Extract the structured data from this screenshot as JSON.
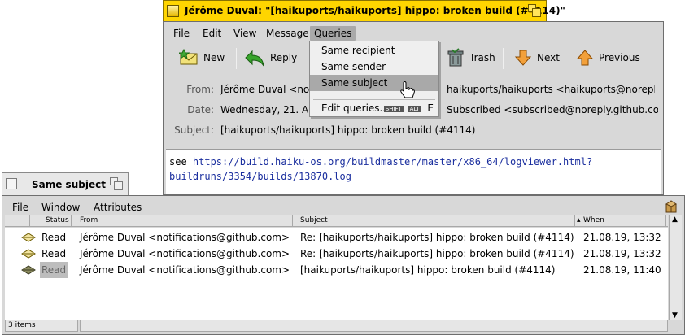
{
  "mail": {
    "title": "Jérôme Duval: \"[haikuports/haikuports] hippo: broken build (#4114)\"",
    "menu": [
      "File",
      "Edit",
      "View",
      "Message",
      "Queries"
    ],
    "toolbar": {
      "new": "New",
      "reply": "Reply",
      "trash": "Trash",
      "next": "Next",
      "previous": "Previous"
    },
    "headers": {
      "from_label": "From:",
      "from_value": "Jérôme Duval <notifi",
      "from_value_right": "haikuports/haikuports <haikuports@noreply.git",
      "date_label": "Date:",
      "date_value": "Wednesday, 21. Augu",
      "date_value_right": "Subscribed <subscribed@noreply.github.com>",
      "subject_label": "Subject:",
      "subject_value": "[haikuports/haikuports] hippo: broken build (#4114)"
    },
    "body": {
      "prefix": "see ",
      "link_line1": "https://build.haiku-os.org/buildmaster/master/x86_64/logviewer.html?",
      "link_line2": "buildruns/3354/builds/13870.log"
    },
    "queries_menu": {
      "items": [
        "Same recipient",
        "Same sender",
        "Same subject"
      ],
      "selected_index": 2,
      "edit": "Edit queries...",
      "shortcut_shift": "SHIFT",
      "shortcut_alt": "ALT",
      "shortcut_key": "E"
    }
  },
  "results": {
    "title": "Same subject",
    "menu": [
      "File",
      "Window",
      "Attributes"
    ],
    "columns": {
      "status": "Status",
      "from": "From",
      "subject": "Subject",
      "when": "When"
    },
    "rows": [
      {
        "status": "Read",
        "from": "Jérôme Duval <notifications@github.com>",
        "subject": "Re: [haikuports/haikuports] hippo: broken build (#4114)",
        "when": "21.08.19, 13:32"
      },
      {
        "status": "Read",
        "from": "Jérôme Duval <notifications@github.com>",
        "subject": "Re: [haikuports/haikuports] hippo: broken build (#4114)",
        "when": "21.08.19, 13:32"
      },
      {
        "status": "Read",
        "from": "Jérôme Duval <notifications@github.com>",
        "subject": "[haikuports/haikuports] hippo: broken build (#4114)",
        "when": "21.08.19, 11:40"
      }
    ],
    "item_count": "3 items"
  },
  "colors": {
    "window_tab_active": "#ffd500",
    "menu_highlight": "#a9a9a9",
    "link": "#1a2e9e"
  }
}
